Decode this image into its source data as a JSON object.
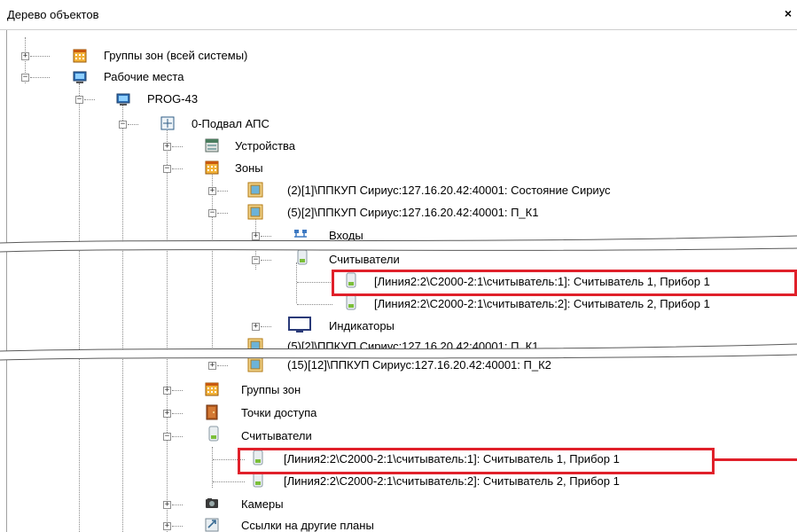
{
  "panel": {
    "title": "Дерево объектов",
    "close": "×"
  },
  "tree": {
    "groups_all": "Группы зон (всей системы)",
    "workstations": "Рабочие места",
    "prog": "PROG-43",
    "plan": "0-Подвал АПС",
    "devices": "Устройства",
    "zones": "Зоны",
    "zone2": "(2)[1]\\ППКУП Сириус:127.16.20.42:40001: Состояние Сириус",
    "zone5": "(5)[2]\\ППКУП Сириус:127.16.20.42:40001: П_К1",
    "inputs": "Входы",
    "readers_a": "Считыватели",
    "reader1_a": "[Линия2:2\\С2000-2:1\\считыватель:1]: Считыватель 1, Прибор 1",
    "reader2_a": "[Линия2:2\\С2000-2:1\\считыватель:2]: Считыватель 2, Прибор 1",
    "indicators": "Индикаторы",
    "zone5_dup": "(5)[2]\\ППКУП Сириус:127.16.20.42:40001: П_К1",
    "zone15": "(15)[12]\\ППКУП Сириус:127.16.20.42:40001: П_К2",
    "zone_groups": "Группы зон",
    "access_points": "Точки доступа",
    "readers_b": "Считыватели",
    "reader1_b": "[Линия2:2\\С2000-2:1\\считыватель:1]: Считыватель 1, Прибор 1",
    "reader2_b": "[Линия2:2\\С2000-2:1\\считыватель:2]: Считыватель 2, Прибор 1",
    "cameras": "Камеры",
    "links": "Ссылки на другие планы"
  },
  "colors": {
    "highlight": "#e0202a",
    "zone_icon": "#e8a21a",
    "reader_icon": "#7bbf3a"
  }
}
